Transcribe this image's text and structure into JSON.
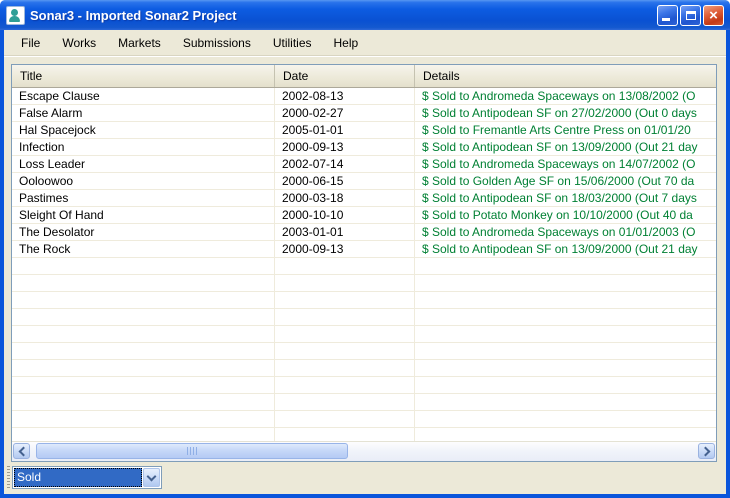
{
  "window": {
    "title": "Sonar3 - Imported Sonar2 Project",
    "controls": {
      "minimize": "minimize",
      "maximize": "maximize",
      "close_glyph": "×"
    }
  },
  "menu": {
    "items": [
      {
        "label": "File"
      },
      {
        "label": "Works"
      },
      {
        "label": "Markets"
      },
      {
        "label": "Submissions"
      },
      {
        "label": "Utilities"
      },
      {
        "label": "Help"
      }
    ]
  },
  "table": {
    "columns": [
      {
        "label": "Title"
      },
      {
        "label": "Date"
      },
      {
        "label": "Details"
      }
    ],
    "rows": [
      {
        "title": "Escape Clause",
        "date": "2002-08-13",
        "details": "$ Sold to Andromeda Spaceways on 13/08/2002 (O"
      },
      {
        "title": "False Alarm",
        "date": "2000-02-27",
        "details": "$ Sold to Antipodean SF on 27/02/2000 (Out 0 days"
      },
      {
        "title": "Hal Spacejock",
        "date": "2005-01-01",
        "details": "$ Sold to Fremantle Arts Centre Press on 01/01/20"
      },
      {
        "title": "Infection",
        "date": "2000-09-13",
        "details": "$ Sold to Antipodean SF on 13/09/2000 (Out 21 day"
      },
      {
        "title": "Loss Leader",
        "date": "2002-07-14",
        "details": "$ Sold to Andromeda Spaceways on 14/07/2002 (O"
      },
      {
        "title": "Ooloowoo",
        "date": "2000-06-15",
        "details": "$ Sold to Golden Age SF on 15/06/2000 (Out 70 da"
      },
      {
        "title": "Pastimes",
        "date": "2000-03-18",
        "details": "$ Sold to Antipodean SF on 18/03/2000 (Out 7 days"
      },
      {
        "title": "Sleight Of Hand",
        "date": "2000-10-10",
        "details": "$ Sold to Potato Monkey on 10/10/2000 (Out 40 da"
      },
      {
        "title": "The Desolator",
        "date": "2003-01-01",
        "details": "$ Sold to Andromeda Spaceways on 01/01/2003 (O"
      },
      {
        "title": "The Rock",
        "date": "2000-09-13",
        "details": "$ Sold to Antipodean SF on 13/09/2000 (Out 21 day"
      }
    ],
    "empty_row_count": 11
  },
  "statusbar": {
    "filter_value": "Sold"
  },
  "colors": {
    "titlebar_blue": "#0d5ce2",
    "window_border": "#0A55DB",
    "client_beige": "#ECE9D8",
    "control_border": "#7F9DB9",
    "selection_blue": "#316AC5",
    "details_green": "#008033",
    "close_red": "#c43a16"
  }
}
